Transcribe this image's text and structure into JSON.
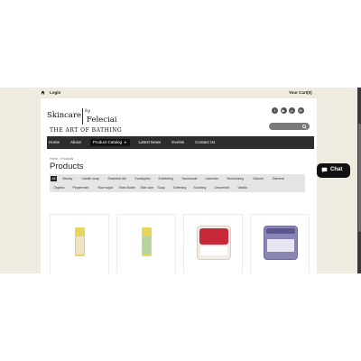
{
  "topbar": {
    "login": "Login",
    "cart": "Your Cart(0)"
  },
  "logo": {
    "line1": "Skincare",
    "by": "by",
    "name": "Feleciai",
    "line2": "THE ART OF BATHING"
  },
  "social": [
    {
      "icon": "facebook-icon",
      "glyph": "f"
    },
    {
      "icon": "youtube-icon",
      "glyph": "▶"
    },
    {
      "icon": "pinterest-icon",
      "glyph": "p"
    },
    {
      "icon": "email-icon",
      "glyph": "✉"
    }
  ],
  "nav": {
    "home": "Home",
    "about": "About",
    "catalog": "Product Catalog",
    "news": "Latest News",
    "events": "Events",
    "contact": "Contact Us"
  },
  "breadcrumb": {
    "home": "Home",
    "sep": "›",
    "current": "Products"
  },
  "page_title": "Products",
  "filters": {
    "row1": [
      "All",
      "Beauty",
      "Castile soap",
      "Essential oils",
      "Eucalyptus",
      "Exfoliating",
      "Handmade",
      "Lavender",
      "Moisturizing",
      "Natural",
      "Oatmeal"
    ],
    "row2": [
      "Organic",
      "Peppermint",
      "Raw sugar",
      "Shea Butter",
      "Skin care",
      "Soap",
      "Softening",
      "Soothing",
      "Unscented",
      "Vanilla"
    ]
  },
  "chat": {
    "label": "Chat"
  },
  "colors": {
    "nav_bg": "#2d2d2d",
    "page_bg": "#efebe1",
    "chat_bg": "#111111"
  }
}
